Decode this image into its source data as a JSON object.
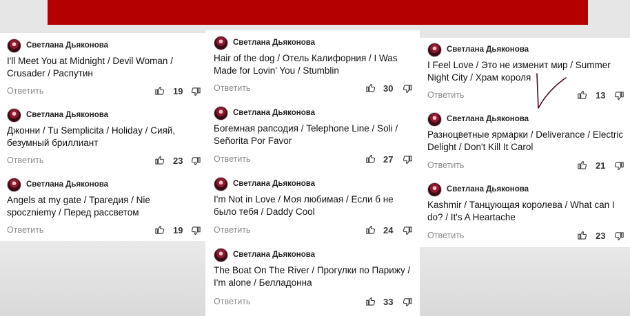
{
  "reply_label": "Ответить",
  "columns": [
    {
      "comments": [
        {
          "author": "Светлана Дьяконова",
          "text": "I'll Meet You at Midnight / Devil Woman  / Crusader / Распутин",
          "likes": "19"
        },
        {
          "author": "Светлана Дьяконова",
          "text": "Джонни / Tu Semplicita / Holiday / Сияй, безумный бриллиант",
          "likes": "23"
        },
        {
          "author": "Светлана Дьяконова",
          "text": "Angels at my gate / Трагедия / Nie spoczniemy / Перед рассветом",
          "likes": "19"
        }
      ]
    },
    {
      "comments": [
        {
          "author": "Светлана Дьяконова",
          "text": "Hair of the dog / Отель Калифорния / I Was Made for Lovin' You / Stumblin",
          "likes": "30"
        },
        {
          "author": "Светлана Дьяконова",
          "text": "Богемная рапсодия / Telephone Line / Soli / Señorita Por Favor",
          "likes": "27"
        },
        {
          "author": "Светлана Дьяконова",
          "text": "I'm Not in Love  / Моя любимая / Если б не было тебя / Daddy Cool",
          "likes": "24"
        },
        {
          "author": "Светлана Дьяконова",
          "text": "The Boat On The River / Прогулки по Парижу / I'm alone / Белладонна",
          "likes": "33"
        }
      ]
    },
    {
      "comments": [
        {
          "author": "Светлана Дьяконова",
          "text": "I Feel Love / Это не изменит мир / Summer Night City / Храм короля",
          "likes": "13"
        },
        {
          "author": "Светлана Дьяконова",
          "text": "Разноцветные ярмарки / Deliverance / Electric Delight  / Don't Kill It Carol",
          "likes": "21"
        },
        {
          "author": "Светлана Дьяконова",
          "text": "Kashmir / Танцующая королева /  What can I do? / It's A Heartache",
          "likes": "23"
        }
      ]
    }
  ]
}
